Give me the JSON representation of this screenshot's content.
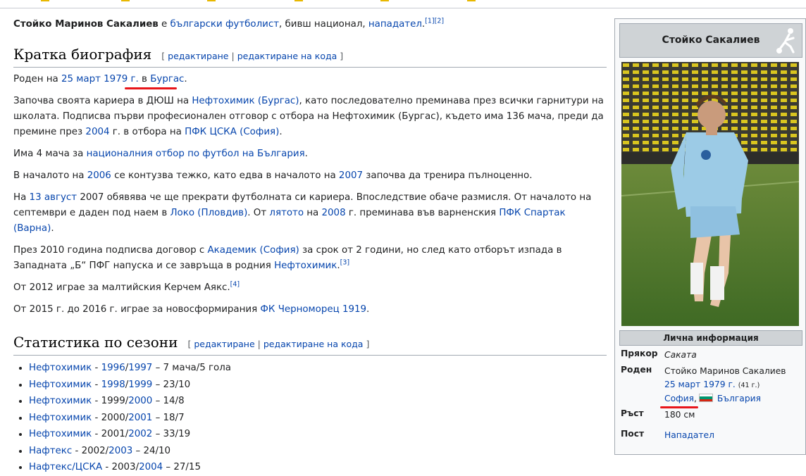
{
  "intro": {
    "name_bold": "Стойко Маринов Сакалиев",
    "t1": " е ",
    "link_nationality": "български футболист",
    "t2": ", бивш национал, ",
    "link_position": "нападател",
    "t3": ".",
    "refs": "[1][2]"
  },
  "sections": {
    "bio_title": "Кратка биография",
    "stats_title": "Статистика по сезони",
    "edit": "редактиране",
    "edit_code": "редактиране на кода",
    "sep": "|",
    "open": "[",
    "close": "]"
  },
  "bio": {
    "p1": {
      "a": "Роден на ",
      "l_date": "25 март 1979 г.",
      "b": " в ",
      "l_place": "Бургас",
      "c": "."
    },
    "p2": {
      "a": "Започва своята кариера в ДЮШ на ",
      "l1": "Нефтохимик (Бургас)",
      "b": ", като последователно преминава през всички гарнитури на школата. Подписва първи професионален отговор с отбора на Нефтохимик (Бургас), където има 136 мача, преди да премине през ",
      "l2": "2004",
      "c": " г. в отбора на ",
      "l3": "ПФК ЦСКА (София)",
      "d": "."
    },
    "p3": {
      "a": "Има 4 мача за ",
      "l1": "националния отбор по футбол на България",
      "b": "."
    },
    "p4": {
      "a": "В началото на ",
      "l1": "2006",
      "b": " се контузва тежко, като едва в началото на ",
      "l2": "2007",
      "c": " започва да тренира пълноценно."
    },
    "p5": {
      "a": "На ",
      "l1": "13 август",
      "b": " 2007 обявява че ще прекрати футболната си кариера. Впоследствие обаче размисля. От началото на септември е даден под наем в ",
      "l2": "Локо (Пловдив)",
      "c": ". От ",
      "l3": "лятото",
      "d": " на ",
      "l4": "2008",
      "e": " г. преминава във варненския ",
      "l5": "ПФК Спартак (Варна)",
      "f": "."
    },
    "p6": {
      "a": "През 2010 година подписва договор с ",
      "l1": "Академик (София)",
      "b": " за срок от 2 години, но след като отборът изпада в Западната „Б“ ПФГ напуска и се завръща в родния ",
      "l2": "Нефтохимик",
      "c": ".",
      "ref": "[3]"
    },
    "p7": {
      "a": "От 2012 играе за малтийския Керчем Аякс.",
      "ref": "[4]"
    },
    "p8": {
      "a": "От 2015 г. до 2016 г. играе за новосформирания ",
      "l1": "ФК Черноморец 1919",
      "b": "."
    }
  },
  "seasons": [
    {
      "club": "Нефтохимик",
      "y1": "1996",
      "y1link": true,
      "slash": "/",
      "y2": "1997",
      "stat": " – 7 мача/5 гола"
    },
    {
      "club": "Нефтохимик",
      "y1": "1998",
      "y1link": true,
      "slash": "/",
      "y2": "1999",
      "stat": " – 23/10"
    },
    {
      "club": "Нефтохимик",
      "y1": "1999",
      "y1link": false,
      "slash": "/",
      "y2": "2000",
      "stat": " – 14/8"
    },
    {
      "club": "Нефтохимик",
      "y1": "2000",
      "y1link": false,
      "slash": "/",
      "y2": "2001",
      "stat": " – 18/7"
    },
    {
      "club": "Нефтохимик",
      "y1": "2001",
      "y1link": false,
      "slash": "/",
      "y2": "2002",
      "stat": " – 33/19"
    },
    {
      "club": "Нафтекс",
      "y1": "2002",
      "y1link": false,
      "slash": "/",
      "y2": "2003",
      "stat": " – 24/10"
    },
    {
      "club": "Нафтекс/ЦСКА",
      "y1": "2003",
      "y1link": false,
      "slash": "/",
      "y2": "2004",
      "stat": " – 27/15"
    }
  ],
  "infobox": {
    "title": "Стойко Сакалиев",
    "section": "Лична информация",
    "nickname_label": "Прякор",
    "nickname": "Саката",
    "born_label": "Роден",
    "born_name": "Стойко Маринов Сакалиев",
    "born_date": "25 март 1979 г.",
    "born_age": "(41 г.)",
    "born_city": "София",
    "born_country": "България",
    "height_label": "Ръст",
    "height": "180 см",
    "position_label": "Пост",
    "position": "Нападател"
  },
  "colors": {
    "link": "#0645ad",
    "underline": "#e8151a",
    "header_bg": "#cfd3d6",
    "flag_white": "#ffffff",
    "flag_green": "#00966e",
    "flag_red": "#d62612"
  },
  "icons": {
    "infobox_icon": "soccer-player-icon"
  }
}
